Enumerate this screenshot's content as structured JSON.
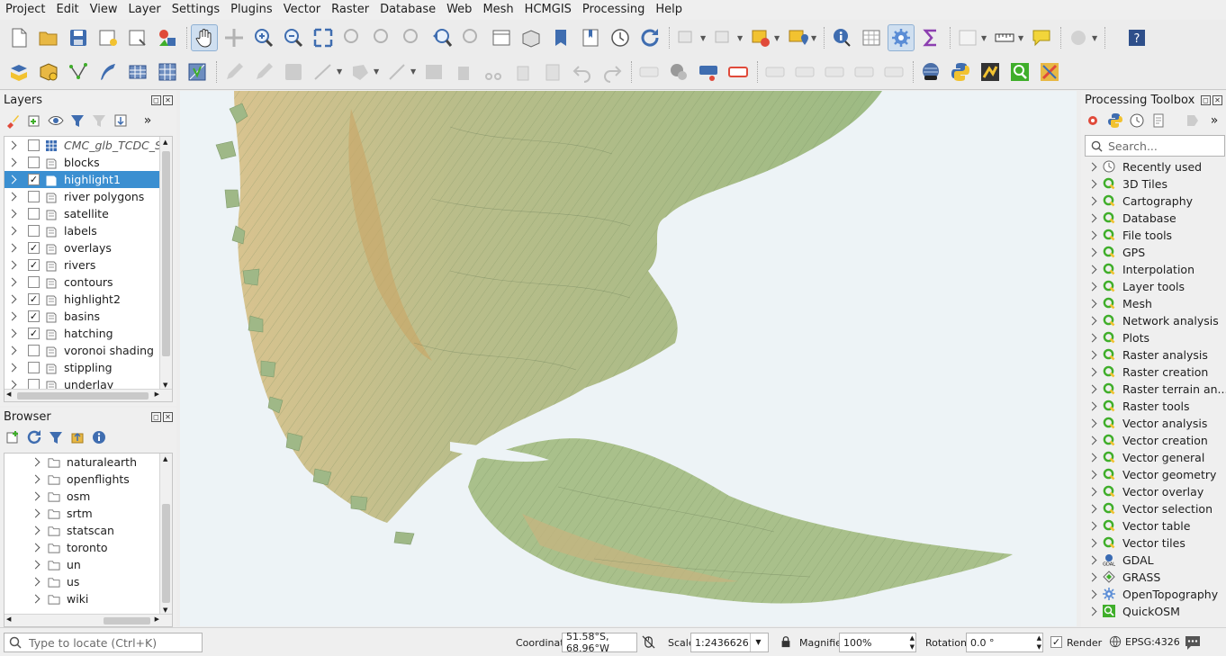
{
  "menu": [
    "Project",
    "Edit",
    "View",
    "Layer",
    "Settings",
    "Plugins",
    "Vector",
    "Raster",
    "Database",
    "Web",
    "Mesh",
    "HCMGIS",
    "Processing",
    "Help"
  ],
  "layers_panel": {
    "title": "Layers",
    "items": [
      {
        "name": "CMC_glb_TCDC_SFC_",
        "checked": false,
        "italic": true
      },
      {
        "name": "blocks",
        "checked": false
      },
      {
        "name": "highlight1",
        "checked": true,
        "selected": true
      },
      {
        "name": "river polygons",
        "checked": false
      },
      {
        "name": "satellite",
        "checked": false
      },
      {
        "name": "labels",
        "checked": false
      },
      {
        "name": "overlays",
        "checked": true
      },
      {
        "name": "rivers",
        "checked": true
      },
      {
        "name": "contours",
        "checked": false
      },
      {
        "name": "highlight2",
        "checked": true
      },
      {
        "name": "basins",
        "checked": true
      },
      {
        "name": "hatching",
        "checked": true
      },
      {
        "name": "voronoi shading",
        "checked": false
      },
      {
        "name": "stippling",
        "checked": false
      },
      {
        "name": "underlay",
        "checked": false
      }
    ]
  },
  "browser_panel": {
    "title": "Browser",
    "items": [
      "naturalearth",
      "openflights",
      "osm",
      "srtm",
      "statscan",
      "toronto",
      "un",
      "us",
      "wiki"
    ]
  },
  "processing_toolbox": {
    "title": "Processing Toolbox",
    "search_placeholder": "Search...",
    "items": [
      {
        "label": "Recently used",
        "icon": "clock-icon"
      },
      {
        "label": "3D Tiles",
        "icon": "qgis-icon"
      },
      {
        "label": "Cartography",
        "icon": "qgis-icon"
      },
      {
        "label": "Database",
        "icon": "qgis-icon"
      },
      {
        "label": "File tools",
        "icon": "qgis-icon"
      },
      {
        "label": "GPS",
        "icon": "qgis-icon"
      },
      {
        "label": "Interpolation",
        "icon": "qgis-icon"
      },
      {
        "label": "Layer tools",
        "icon": "qgis-icon"
      },
      {
        "label": "Mesh",
        "icon": "qgis-icon"
      },
      {
        "label": "Network analysis",
        "icon": "qgis-icon"
      },
      {
        "label": "Plots",
        "icon": "qgis-icon"
      },
      {
        "label": "Raster analysis",
        "icon": "qgis-icon"
      },
      {
        "label": "Raster creation",
        "icon": "qgis-icon"
      },
      {
        "label": "Raster terrain an...",
        "icon": "qgis-icon"
      },
      {
        "label": "Raster tools",
        "icon": "qgis-icon"
      },
      {
        "label": "Vector analysis",
        "icon": "qgis-icon"
      },
      {
        "label": "Vector creation",
        "icon": "qgis-icon"
      },
      {
        "label": "Vector general",
        "icon": "qgis-icon"
      },
      {
        "label": "Vector geometry",
        "icon": "qgis-icon"
      },
      {
        "label": "Vector overlay",
        "icon": "qgis-icon"
      },
      {
        "label": "Vector selection",
        "icon": "qgis-icon"
      },
      {
        "label": "Vector table",
        "icon": "qgis-icon"
      },
      {
        "label": "Vector tiles",
        "icon": "qgis-icon"
      },
      {
        "label": "GDAL",
        "icon": "gdal-icon"
      },
      {
        "label": "GRASS",
        "icon": "grass-icon"
      },
      {
        "label": "OpenTopography",
        "icon": "gear-icon"
      },
      {
        "label": "QuickOSM",
        "icon": "quickosm-icon"
      }
    ]
  },
  "statusbar": {
    "locate_placeholder": "Type to locate (Ctrl+K)",
    "coordinate_label": "Coordinate",
    "coordinate_value": "51.58°S, 68.96°W",
    "scale_label": "Scale",
    "scale_value": "1:2436626",
    "magnifier_label": "Magnifier",
    "magnifier_value": "100%",
    "rotation_label": "Rotation",
    "rotation_value": "0.0 °",
    "render_label": "Render",
    "crs": "EPSG:4326"
  },
  "colors": {
    "selection": "#3b8fd1",
    "qgis_green": "#3fae2a",
    "ocean": "#edf3f6",
    "land_green": "#9dbb84",
    "highland": "#d9c79a"
  }
}
